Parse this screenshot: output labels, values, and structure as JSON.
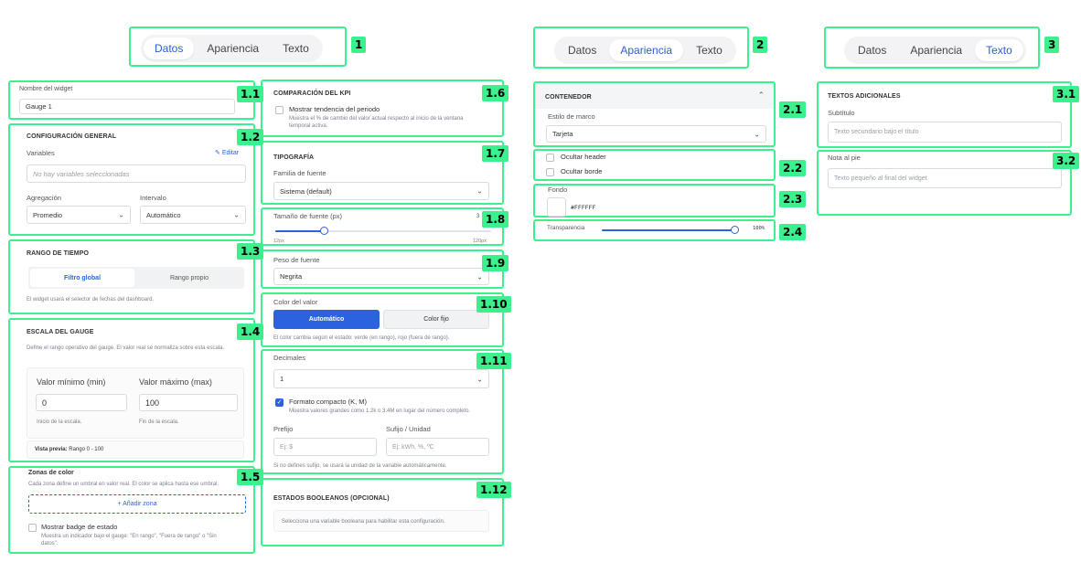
{
  "badges": [
    "1",
    "1.1",
    "1.2",
    "1.3",
    "1.4",
    "1.5",
    "1.6",
    "1.7",
    "1.8",
    "1.9",
    "1.10",
    "1.11",
    "1.12",
    "2",
    "2.1",
    "2.2",
    "2.3",
    "2.4",
    "3",
    "3.1",
    "3.2"
  ],
  "tabs": {
    "datos": "Datos",
    "apariencia": "Apariencia",
    "texto": "Texto"
  },
  "widget_name": {
    "label": "Nombre del widget",
    "value": "Gauge 1"
  },
  "config_general": {
    "title": "CONFIGURACIÓN GENERAL",
    "variables_label": "Variables",
    "edit_label": "Editar",
    "variables_placeholder": "No hay variables seleccionadas",
    "aggregation_label": "Agregación",
    "aggregation_value": "Promedio",
    "interval_label": "Intervalo",
    "interval_value": "Automático"
  },
  "time_range": {
    "title": "RANGO DE TIEMPO",
    "option_global": "Filtro global",
    "option_own": "Rango propio",
    "note": "El widget usará el selector de fechas del dashboard."
  },
  "gauge_scale": {
    "title": "ESCALA DEL GAUGE",
    "description": "Define el rango operativo del gauge. El valor real se normaliza sobre esta escala.",
    "min_label": "Valor mínimo (min)",
    "min_value": "0",
    "min_hint": "Inicio de la escala.",
    "max_label": "Valor máximo (max)",
    "max_value": "100",
    "max_hint": "Fin de la escala.",
    "preview_label": "Vista previa:",
    "preview_value": "Rango 0 - 100"
  },
  "color_zones": {
    "title": "Zonas de color",
    "description": "Cada zona define un umbral en valor real. El color se aplica hasta ese umbral.",
    "add_label": "+ Añadir zona",
    "badge_label": "Mostrar badge de estado",
    "badge_desc": "Muestra un indicador bajo el gauge: \"En rango\", \"Fuera de rango\" o \"Sin datos\"."
  },
  "kpi_compare": {
    "title": "COMPARACIÓN DEL KPI",
    "trend_label": "Mostrar tendencia del periodo",
    "trend_desc": "Muestra el % de cambio del valor actual respecto al inicio de la ventana temporal activa."
  },
  "typography": {
    "title": "TIPOGRAFÍA",
    "family_label": "Familia de fuente",
    "family_value": "Sistema (default)"
  },
  "font_size": {
    "label": "Tamaño de fuente (px)",
    "value_short": "3",
    "min": "12px",
    "max": "120px",
    "fraction": 0.23
  },
  "font_weight": {
    "label": "Peso de fuente",
    "value": "Negrita"
  },
  "value_color": {
    "label": "Color del valor",
    "auto": "Automático",
    "fixed": "Color fijo",
    "note": "El color cambia según el estado: verde (en rango), rojo (fuera de rango)."
  },
  "decimals": {
    "label": "Decimales",
    "value": "1",
    "compact_label": "Formato compacto (K, M)",
    "compact_desc": "Muestra valores grandes como 1.2k o 3.4M en lugar del número completo.",
    "prefix_label": "Prefijo",
    "prefix_placeholder": "Ej: $",
    "suffix_label": "Sufijo / Unidad",
    "suffix_placeholder": "Ej: kWh, %, ºC",
    "note": "Si no defines sufijo, se usará la unidad de la variable automáticamente."
  },
  "boolean_states": {
    "title": "ESTADOS BOOLEANOS (OPCIONAL)",
    "note": "Selecciona una variable booleana para habilitar esta configuración."
  },
  "container": {
    "title": "CONTENEDOR",
    "style_label": "Estilo de marco",
    "style_value": "Tarjeta"
  },
  "visibility": {
    "hide_header": "Ocultar header",
    "hide_border": "Ocultar borde"
  },
  "background": {
    "label": "Fondo",
    "value": "#FFFFFF"
  },
  "transparency": {
    "label": "Transparencia",
    "value": "100%",
    "fraction": 1.0
  },
  "extra_texts": {
    "title": "TEXTOS ADICIONALES",
    "subtitle_label": "Subtítulo",
    "subtitle_placeholder": "Texto secundario bajo el título"
  },
  "footer_note": {
    "label": "Nota al pie",
    "placeholder": "Texto pequeño al final del widget"
  },
  "colors": {
    "accent": "#2b63df",
    "highlight": "#3df08e"
  }
}
